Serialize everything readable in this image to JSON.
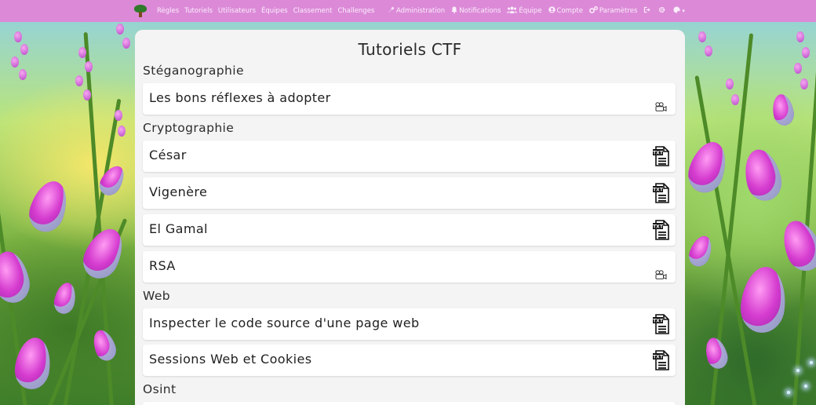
{
  "nav": {
    "left_links": [
      "Règles",
      "Tutoriels",
      "Utilisateurs",
      "Équipes",
      "Classement",
      "Challenges"
    ],
    "admin": "Administration",
    "notifications": "Notifications",
    "team": "Équipe",
    "account": "Compte",
    "settings": "Paramètres"
  },
  "page": {
    "title": "Tutoriels CTF"
  },
  "sections": [
    {
      "title": "Stéganographie",
      "items": [
        {
          "label": "Les bons réflexes à adopter",
          "icon": "video-icon"
        }
      ]
    },
    {
      "title": "Cryptographie",
      "items": [
        {
          "label": "César",
          "icon": "txt-document-icon"
        },
        {
          "label": "Vigenère",
          "icon": "txt-document-icon"
        },
        {
          "label": "El Gamal",
          "icon": "txt-document-icon"
        },
        {
          "label": "RSA",
          "icon": "video-icon"
        }
      ]
    },
    {
      "title": "Web",
      "items": [
        {
          "label": "Inspecter le code source d'une page web",
          "icon": "txt-document-icon"
        },
        {
          "label": "Sessions Web et Cookies",
          "icon": "txt-document-icon"
        }
      ]
    },
    {
      "title": "Osint",
      "items": []
    }
  ],
  "icons": {
    "doc_badge_text": "TXT"
  },
  "colors": {
    "navbar": "#dc8ad8",
    "card": "#f4f4f4",
    "item": "#ffffff"
  }
}
